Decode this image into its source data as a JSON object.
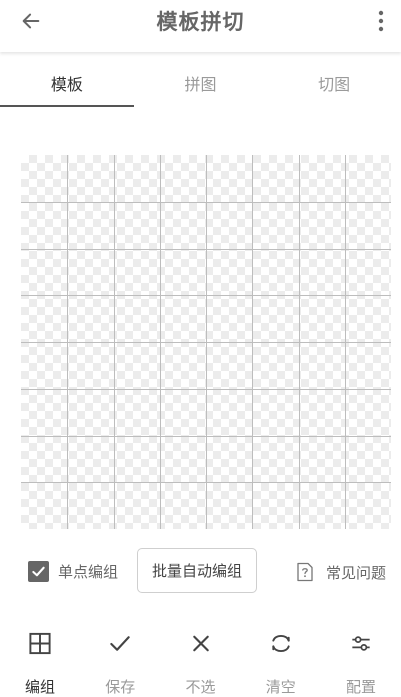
{
  "appbar": {
    "title": "模板拼切",
    "back_icon": "arrow-left-icon",
    "more_icon": "more-vertical-icon"
  },
  "tabs": [
    {
      "label": "模板",
      "active": true
    },
    {
      "label": "拼图",
      "active": false
    },
    {
      "label": "切图",
      "active": false
    }
  ],
  "canvas": {
    "grid_columns": 8,
    "grid_rows": 8,
    "background": "transparent-checkerboard",
    "grid_color": "#bdbdbd"
  },
  "options": {
    "single_edit_label": "单点编组",
    "single_edit_checked": true,
    "batch_button_label": "批量自动编组",
    "faq_label": "常见问题",
    "faq_icon": "help-document-icon"
  },
  "toolbar": [
    {
      "label": "编组",
      "icon": "grid-icon",
      "active": true
    },
    {
      "label": "保存",
      "icon": "check-icon",
      "active": false
    },
    {
      "label": "不选",
      "icon": "close-icon",
      "active": false
    },
    {
      "label": "清空",
      "icon": "clear-icon",
      "active": false
    },
    {
      "label": "配置",
      "icon": "settings-sliders-icon",
      "active": false
    }
  ],
  "colors": {
    "text_primary": "#333333",
    "text_secondary": "#9a9a9a",
    "checkbox": "#666666",
    "tab_indicator": "#555555"
  }
}
